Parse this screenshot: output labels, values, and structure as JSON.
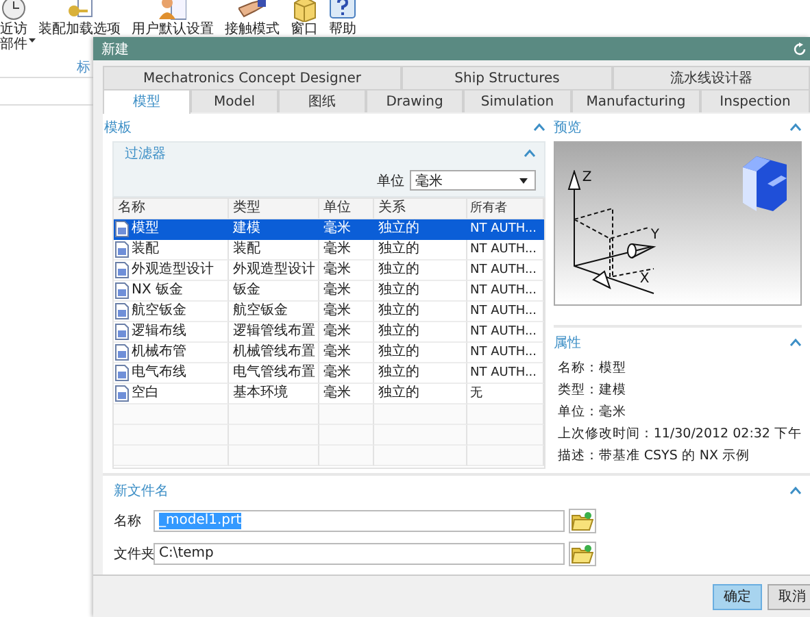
{
  "background_app": {
    "ribbon": [
      {
        "lines": [
          "近访",
          "部件"
        ],
        "dropdown": true
      },
      {
        "lines": [
          "装配加载选项"
        ]
      },
      {
        "lines": [
          "用户默认设置"
        ]
      },
      {
        "lines": [
          "接触模式"
        ]
      },
      {
        "lines": [
          "窗口"
        ]
      },
      {
        "lines": [
          "帮助"
        ]
      }
    ],
    "group_label": "标"
  },
  "dialog": {
    "title": "新建",
    "tabs_row_1": [
      {
        "label": "Mechatronics Concept Designer",
        "selected": false
      },
      {
        "label": "Ship Structures",
        "selected": false
      },
      {
        "label": "流水线设计器",
        "selected": false
      }
    ],
    "tabs_row_2": [
      {
        "label": "模型",
        "selected": true
      },
      {
        "label": "Model",
        "selected": false
      },
      {
        "label": "图纸",
        "selected": false
      },
      {
        "label": "Drawing",
        "selected": false
      },
      {
        "label": "Simulation",
        "selected": false
      },
      {
        "label": "Manufacturing",
        "selected": false
      },
      {
        "label": "Inspection",
        "selected": false
      }
    ],
    "templates": {
      "title": "模板",
      "expanded": true,
      "filter": {
        "title": "过滤器",
        "expanded": true,
        "unit_label": "单位",
        "unit_value": "毫米"
      },
      "table": {
        "columns": [
          "名称",
          "类型",
          "单位",
          "关系",
          "所有者"
        ],
        "rows": [
          {
            "cells": [
              "模型",
              "建模",
              "毫米",
              "独立的",
              "NT AUTH..."
            ],
            "selected": true
          },
          {
            "cells": [
              "装配",
              "装配",
              "毫米",
              "独立的",
              "NT AUTH..."
            ],
            "selected": false
          },
          {
            "cells": [
              "外观造型设计",
              "外观造型设计",
              "毫米",
              "独立的",
              "NT AUTH..."
            ],
            "selected": false
          },
          {
            "cells": [
              "NX 钣金",
              "钣金",
              "毫米",
              "独立的",
              "NT AUTH..."
            ],
            "selected": false
          },
          {
            "cells": [
              "航空钣金",
              "航空钣金",
              "毫米",
              "独立的",
              "NT AUTH..."
            ],
            "selected": false
          },
          {
            "cells": [
              "逻辑布线",
              "逻辑管线布置",
              "毫米",
              "独立的",
              "NT AUTH..."
            ],
            "selected": false
          },
          {
            "cells": [
              "机械布管",
              "机械管线布置",
              "毫米",
              "独立的",
              "NT AUTH..."
            ],
            "selected": false
          },
          {
            "cells": [
              "电气布线",
              "电气管线布置",
              "毫米",
              "独立的",
              "NT AUTH..."
            ],
            "selected": false
          },
          {
            "cells": [
              "空白",
              "基本环境",
              "毫米",
              "独立的",
              "无"
            ],
            "selected": false
          }
        ]
      }
    },
    "preview": {
      "title": "预览",
      "expanded": true,
      "axis_labels": [
        "Z",
        "Y",
        "X"
      ]
    },
    "properties": {
      "title": "属性",
      "expanded": true,
      "lines": [
        "名称：模型",
        "类型：建模",
        "单位：毫米",
        "上次修改时间：11/30/2012 02:32 下午",
        "描述：带基准 CSYS 的 NX 示例"
      ]
    },
    "new_file": {
      "title": "新文件名",
      "expanded": true,
      "fields": [
        {
          "label": "名称",
          "value": "_model1.prt",
          "text_selected": true
        },
        {
          "label": "文件夹",
          "value": "C:\\temp",
          "text_selected": false
        }
      ]
    },
    "buttons": [
      {
        "label": "确定",
        "default": true
      },
      {
        "label": "取消",
        "default": false
      }
    ]
  }
}
